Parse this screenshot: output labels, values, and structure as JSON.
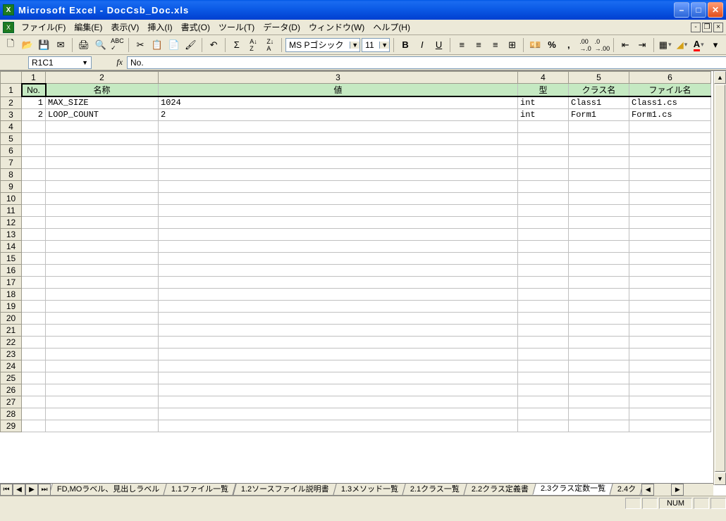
{
  "title": "Microsoft Excel - DocCsb_Doc.xls",
  "menu": [
    "ファイル(F)",
    "編集(E)",
    "表示(V)",
    "挿入(I)",
    "書式(O)",
    "ツール(T)",
    "データ(D)",
    "ウィンドウ(W)",
    "ヘルプ(H)"
  ],
  "toolbar": {
    "font": "MS Pゴシック",
    "size": "11"
  },
  "formula": {
    "name": "R1C1",
    "fx": "fx",
    "value": "No."
  },
  "col_headers": [
    "1",
    "2",
    "3",
    "4",
    "5",
    "6"
  ],
  "row1": {
    "c1": "No.",
    "c2": "名称",
    "c3": "値",
    "c4": "型",
    "c5": "クラス名",
    "c6": "ファイル名"
  },
  "rows": [
    {
      "no": "1",
      "name": "MAX_SIZE",
      "val": "1024",
      "type": "int",
      "cls": "Class1",
      "file": "Class1.cs"
    },
    {
      "no": "2",
      "name": "LOOP_COUNT",
      "val": "2",
      "type": "int",
      "cls": "Form1",
      "file": "Form1.cs"
    }
  ],
  "empty_rows": [
    "4",
    "5",
    "6",
    "7",
    "8",
    "9",
    "10",
    "11",
    "12",
    "13",
    "14",
    "15",
    "16",
    "17",
    "18",
    "19",
    "20",
    "21",
    "22",
    "23",
    "24",
    "25",
    "26",
    "27",
    "28",
    "29"
  ],
  "tabs": {
    "items": [
      "FD,MOラベル、見出しラベル",
      "1.1ファイル一覧",
      "1.2ソースファイル説明書",
      "1.3メソッド一覧",
      "2.1クラス一覧",
      "2.2クラス定義書",
      "2.3クラス定数一覧",
      "2.4ク"
    ],
    "active_index": 6
  },
  "status": {
    "numlock": "NUM"
  }
}
